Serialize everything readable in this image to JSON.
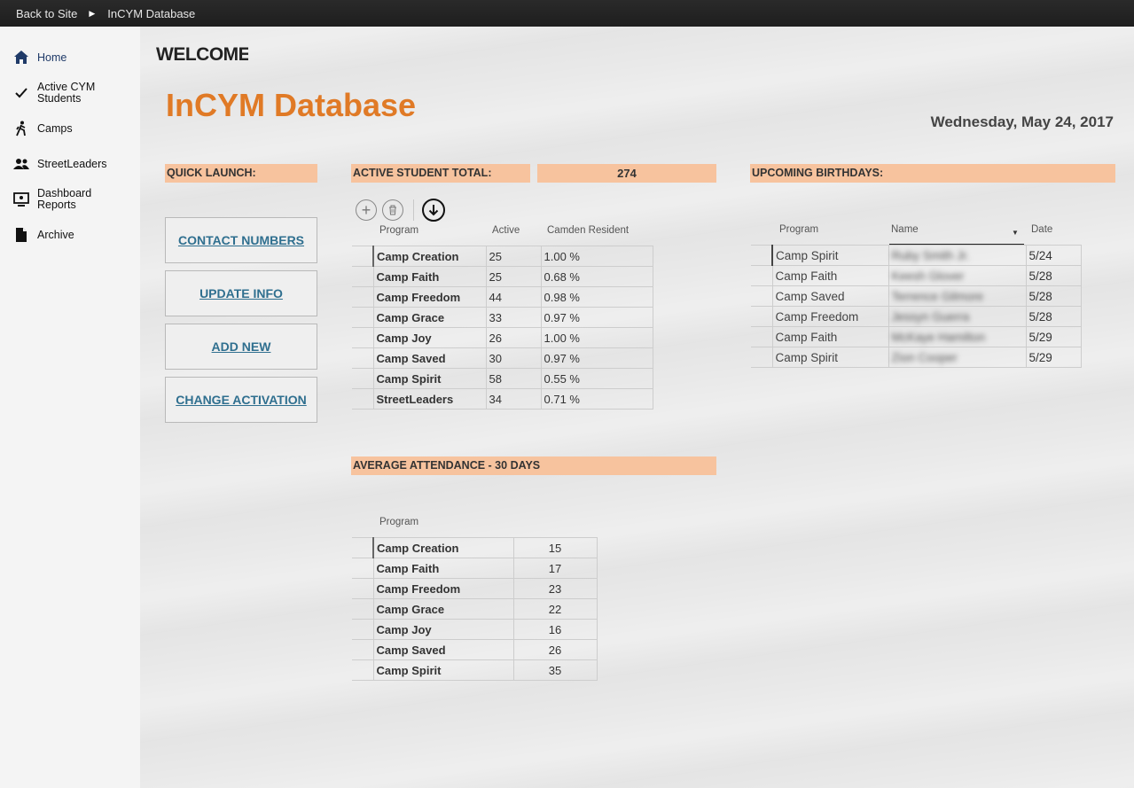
{
  "topbar": {
    "back_label": "Back to Site",
    "current": "InCYM Database"
  },
  "sidebar": {
    "items": [
      {
        "label": "Home",
        "icon": "home-icon"
      },
      {
        "label": "Active CYM Students",
        "icon": "checkmark-icon"
      },
      {
        "label": "Camps",
        "icon": "hiker-icon"
      },
      {
        "label": "StreetLeaders",
        "icon": "people-icon"
      },
      {
        "label": "Dashboard Reports",
        "icon": "dashboard-icon"
      },
      {
        "label": "Archive",
        "icon": "document-icon"
      }
    ]
  },
  "header": {
    "welcome": "WELCOME",
    "title": "InCYM Database",
    "date": "Wednesday, May 24, 2017"
  },
  "quick_launch": {
    "heading": "QUICK LAUNCH:",
    "buttons": [
      "CONTACT NUMBERS",
      "UPDATE INFO",
      "ADD NEW",
      "CHANGE ACTIVATION"
    ]
  },
  "active_students": {
    "heading": "ACTIVE STUDENT TOTAL:",
    "total": "274",
    "columns": [
      "Program",
      "Active",
      "Camden Resident"
    ],
    "rows": [
      [
        "Camp Creation",
        "25",
        "1.00 %"
      ],
      [
        "Camp Faith",
        "25",
        "0.68 %"
      ],
      [
        "Camp Freedom",
        "44",
        "0.98 %"
      ],
      [
        "Camp Grace",
        "33",
        "0.97 %"
      ],
      [
        "Camp Joy",
        "26",
        "1.00 %"
      ],
      [
        "Camp Saved",
        "30",
        "0.97 %"
      ],
      [
        "Camp Spirit",
        "58",
        "0.55 %"
      ],
      [
        "StreetLeaders",
        "34",
        "0.71 %"
      ]
    ]
  },
  "birthdays": {
    "heading": "UPCOMING BIRTHDAYS:",
    "columns": [
      "Program",
      "Name",
      "Date"
    ],
    "rows": [
      [
        "Camp Spirit",
        "Ruby Smith Jr.",
        "5/24"
      ],
      [
        "Camp Faith",
        "Keesh Glover",
        "5/28"
      ],
      [
        "Camp Saved",
        "Terrence Gilmore",
        "5/28"
      ],
      [
        "Camp Freedom",
        "Jessyn Guerra",
        "5/28"
      ],
      [
        "Camp Faith",
        "McKaye Hamilton",
        "5/29"
      ],
      [
        "Camp Spirit",
        "Zion Cooper",
        "5/29"
      ]
    ]
  },
  "attendance": {
    "heading": "AVERAGE ATTENDANCE - 30 DAYS",
    "columns": [
      "Program"
    ],
    "rows": [
      [
        "Camp Creation",
        "15"
      ],
      [
        "Camp Faith",
        "17"
      ],
      [
        "Camp Freedom",
        "23"
      ],
      [
        "Camp Grace",
        "22"
      ],
      [
        "Camp Joy",
        "16"
      ],
      [
        "Camp Saved",
        "26"
      ],
      [
        "Camp Spirit",
        "35"
      ]
    ]
  },
  "colors": {
    "accent_orange": "#e07a26",
    "section_header": "#f7c39e",
    "link_blue": "#2f6f8f"
  }
}
